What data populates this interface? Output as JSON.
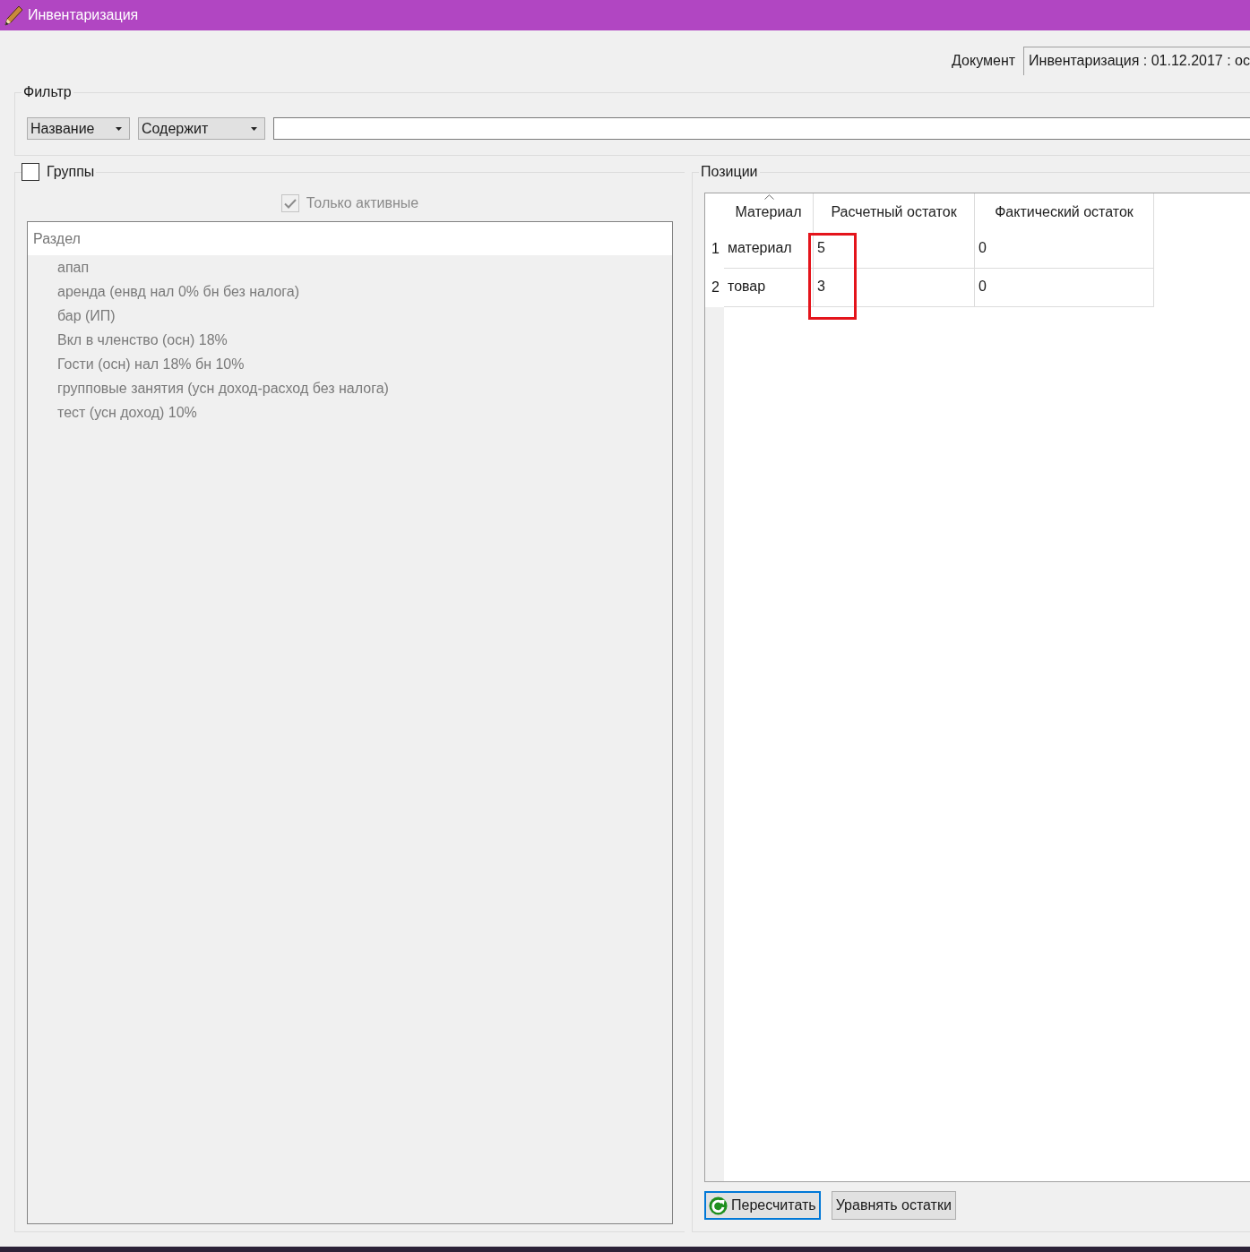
{
  "window": {
    "title": "Инвентаризация"
  },
  "document": {
    "label": "Документ",
    "value": "Инвентаризация : 01.12.2017 : ос"
  },
  "filter": {
    "title": "Фильтр",
    "field": {
      "value": "Название"
    },
    "condition": {
      "value": "Содержит"
    }
  },
  "groups": {
    "label": "Группы",
    "checked": false,
    "only_active": {
      "label": "Только активные",
      "checked": true,
      "disabled": true
    },
    "list": {
      "header": "Раздел",
      "items": [
        "апап",
        "аренда (енвд нал 0% бн без налога)",
        "бар (ИП)",
        "Вкл в членство (осн) 18%",
        "Гости (осн) нал 18% бн 10%",
        "групповые занятия (усн доход-расход без налога)",
        "тест (усн доход) 10%"
      ]
    }
  },
  "positions": {
    "title": "Позиции",
    "table": {
      "columns": [
        {
          "label": "Материал",
          "sorted": true,
          "highlighted": false
        },
        {
          "label": "Расчетный остаток",
          "sorted": false,
          "highlighted": true
        },
        {
          "label": "Фактический остаток",
          "sorted": false,
          "highlighted": false
        }
      ],
      "rows": [
        {
          "number": "1",
          "cells": [
            "материал",
            "5",
            "0"
          ]
        },
        {
          "number": "2",
          "cells": [
            "товар",
            "3",
            "0"
          ]
        }
      ]
    },
    "buttons": [
      {
        "label": "Пересчитать",
        "kind": "refresh",
        "focused": true
      },
      {
        "label": "Уравнять остатки",
        "kind": "text",
        "focused": false
      }
    ]
  }
}
